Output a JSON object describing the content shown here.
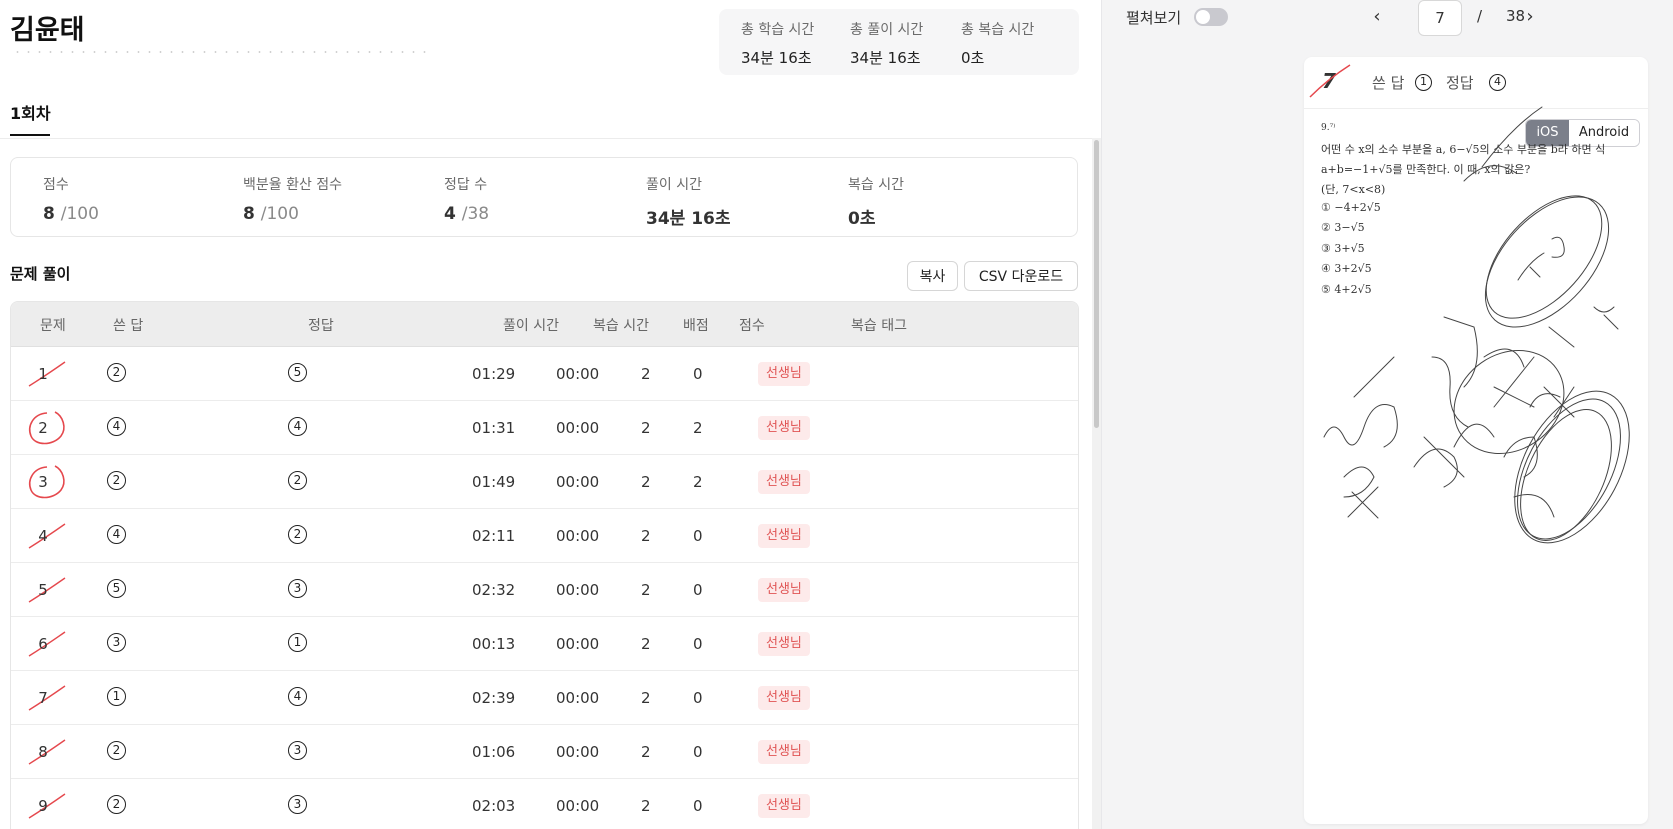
{
  "student": {
    "name": "김윤태"
  },
  "totals": [
    {
      "label": "총 학습 시간",
      "value": "34분 16초"
    },
    {
      "label": "총 풀이 시간",
      "value": "34분 16초"
    },
    {
      "label": "총 복습 시간",
      "value": "0초"
    }
  ],
  "round_tab": "1회차",
  "summary": {
    "score": {
      "label": "점수",
      "value": "8",
      "denom": "/100"
    },
    "percent": {
      "label": "백분율 환산 점수",
      "value": "8",
      "denom": "/100"
    },
    "correct": {
      "label": "정답 수",
      "value": "4",
      "denom": "/38"
    },
    "solve_time": {
      "label": "풀이 시간",
      "value": "34분 16초"
    },
    "review_time": {
      "label": "복습 시간",
      "value": "0초"
    }
  },
  "section": {
    "title": "문제 풀이",
    "copy_button": "복사",
    "csv_button": "CSV 다운로드"
  },
  "table": {
    "headers": [
      "문제",
      "쓴 답",
      "정답",
      "풀이 시간",
      "복습 시간",
      "배점",
      "점수",
      "복습 태그"
    ],
    "rows": [
      {
        "num": "1",
        "wrote": "2",
        "answer": "5",
        "time": "01:29",
        "review": "00:00",
        "points": "2",
        "score": "0",
        "tag": "선생님",
        "correct": false
      },
      {
        "num": "2",
        "wrote": "4",
        "answer": "4",
        "time": "01:31",
        "review": "00:00",
        "points": "2",
        "score": "2",
        "tag": "선생님",
        "correct": true
      },
      {
        "num": "3",
        "wrote": "2",
        "answer": "2",
        "time": "01:49",
        "review": "00:00",
        "points": "2",
        "score": "2",
        "tag": "선생님",
        "correct": true
      },
      {
        "num": "4",
        "wrote": "4",
        "answer": "2",
        "time": "02:11",
        "review": "00:00",
        "points": "2",
        "score": "0",
        "tag": "선생님",
        "correct": false
      },
      {
        "num": "5",
        "wrote": "5",
        "answer": "3",
        "time": "02:32",
        "review": "00:00",
        "points": "2",
        "score": "0",
        "tag": "선생님",
        "correct": false
      },
      {
        "num": "6",
        "wrote": "3",
        "answer": "1",
        "time": "00:13",
        "review": "00:00",
        "points": "2",
        "score": "0",
        "tag": "선생님",
        "correct": false
      },
      {
        "num": "7",
        "wrote": "1",
        "answer": "4",
        "time": "02:39",
        "review": "00:00",
        "points": "2",
        "score": "0",
        "tag": "선생님",
        "correct": false
      },
      {
        "num": "8",
        "wrote": "2",
        "answer": "3",
        "time": "01:06",
        "review": "00:00",
        "points": "2",
        "score": "0",
        "tag": "선생님",
        "correct": false
      },
      {
        "num": "9",
        "wrote": "2",
        "answer": "3",
        "time": "02:03",
        "review": "00:00",
        "points": "2",
        "score": "0",
        "tag": "선생님",
        "correct": false
      }
    ]
  },
  "viewer": {
    "toggle_label": "펼쳐보기",
    "toggle_on": false,
    "page_current": "7",
    "page_separator": "/",
    "page_total": "38",
    "prev_icon": "chevron-left-icon",
    "next_icon": "chevron-right-icon",
    "question_number": "7",
    "wrote_label": "쓴 답",
    "wrote_value": "1",
    "answer_label": "정답",
    "answer_value": "4",
    "platform_ios": "iOS",
    "platform_android": "Android",
    "question_lines": [
      "9.⁷⁾",
      "어떤 수 x의 소수 부분을 a, 6−√5의 소수 부분을 b라 하면 식",
      "a+b=−1+√5를 만족한다. 이 때, x의 값은?",
      "(단, 7<x<8)",
      "① −4+2√5",
      "② 3−√5",
      "③ 3+√5",
      "④ 3+2√5",
      "⑤ 4+2√5"
    ]
  },
  "colors": {
    "wrong_mark": "#e5484d",
    "badge_bg": "#fdeaea",
    "badge_text": "#e05555",
    "ios_active": "#7b7f8a"
  }
}
